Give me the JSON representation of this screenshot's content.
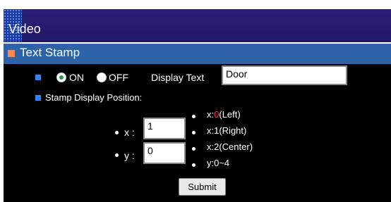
{
  "header": {
    "title": "Video"
  },
  "section": {
    "label": "Text Stamp"
  },
  "controls": {
    "on_label": "ON",
    "off_label": "OFF",
    "display_text_label": "Display Text",
    "display_text_value": "Door",
    "position_label": "Stamp Display Position:",
    "x_label": "x :",
    "y_label": "y :",
    "x_value": "1",
    "y_value": "0",
    "hints": {
      "h1_prefix": "x:",
      "h1_num": "0",
      "h1_suffix": "(Left)",
      "h2": "x:1(Right)",
      "h3": "x:2(Center)",
      "h4": "y:0~4"
    },
    "submit_label": "Submit"
  },
  "colors": {
    "title_bar": "#2b1f78",
    "section_bar": "#2e63a8",
    "panel_bg": "#000000",
    "accent_square": "#2f84ff",
    "section_square": "#ff8a4d",
    "highlight_red": "#ff2a2a"
  },
  "icons": {
    "section_icon": "orange-square",
    "row_bullet": "blue-square",
    "radio_on": "radio-selected",
    "radio_off": "radio-unselected",
    "bullet": "white-dot"
  }
}
